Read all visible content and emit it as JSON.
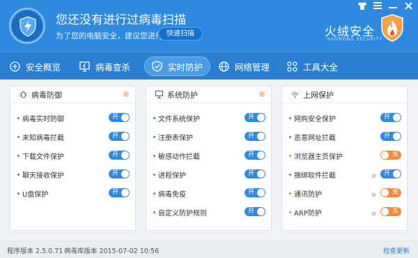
{
  "header": {
    "title": "您还没有进行过病毒扫描",
    "subtitle": "为了您的电脑安全，建议您进行",
    "scan_button": "快速扫描",
    "brand": "火绒安全",
    "brand_en": "HUORONG SECURITY",
    "window_controls": [
      "shirt-icon",
      "menu-icon",
      "minimize-icon",
      "close-icon"
    ]
  },
  "nav": [
    {
      "label": "安全概览",
      "icon": "shield-plus-icon"
    },
    {
      "label": "病毒查杀",
      "icon": "scan-icon"
    },
    {
      "label": "实时防护",
      "icon": "shield-icon",
      "active": true
    },
    {
      "label": "网络管理",
      "icon": "globe-icon"
    },
    {
      "label": "工具大全",
      "icon": "grid-icon"
    }
  ],
  "cards": [
    {
      "title": "病毒防御",
      "icon": "bug-icon",
      "items": [
        {
          "label": "病毒实时防御",
          "state": "开"
        },
        {
          "label": "未知病毒拦截",
          "state": "开"
        },
        {
          "label": "下载文件保护",
          "state": "开"
        },
        {
          "label": "聊天接收保护",
          "state": "开"
        },
        {
          "label": "U盘保护",
          "state": "开"
        }
      ]
    },
    {
      "title": "系统防护",
      "icon": "monitor-icon",
      "items": [
        {
          "label": "文件系统保护",
          "state": "开"
        },
        {
          "label": "注册表保护",
          "state": "开"
        },
        {
          "label": "敏感动作拦截",
          "state": "开"
        },
        {
          "label": "进程保护",
          "state": "开"
        },
        {
          "label": "病毒免疫",
          "state": "开"
        },
        {
          "label": "自定义防护规则",
          "state": "开"
        }
      ]
    },
    {
      "title": "上网保护",
      "icon": "wifi-icon",
      "items": [
        {
          "label": "网购安全保护",
          "state": "开"
        },
        {
          "label": "恶意网址拦截",
          "state": "开"
        },
        {
          "label": "浏览器主页保护",
          "state": "关"
        },
        {
          "label": "捆绑软件拦截",
          "state": "开"
        },
        {
          "label": "通讯防护",
          "state": "关"
        },
        {
          "label": "ARP防护",
          "state": "关"
        }
      ]
    }
  ],
  "status": {
    "version": "程序版本 2.5.0.71",
    "virus_db": "病毒库版本 2015-07-02 10:56",
    "update": "检查更新"
  },
  "colors": {
    "header_bg": "#2f89de",
    "nav_bg": "#2a7fd2",
    "toggle_on": "#2f89de",
    "toggle_off": "#f58a3d"
  }
}
